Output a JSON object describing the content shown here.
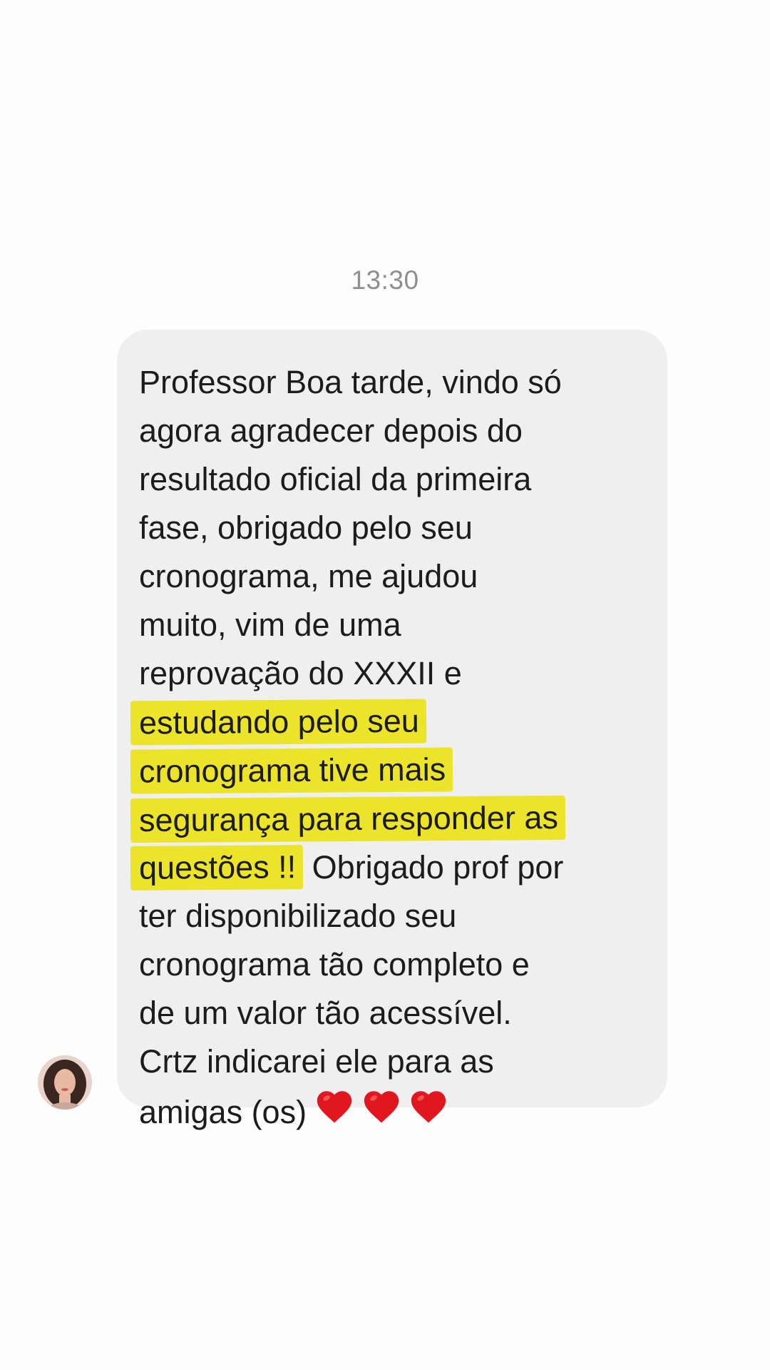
{
  "chat": {
    "timestamp": "13:30",
    "message": {
      "lines": [
        "Professor Boa tarde, vindo só",
        "agora agradecer depois do",
        "resultado oficial da primeira",
        "fase, obrigado pelo seu",
        "cronograma, me ajudou",
        "muito, vim de uma",
        "reprovação do XXXII e",
        "estudando pelo seu",
        "cronograma tive mais",
        "segurança para responder as",
        "questões !!",
        "Obrigado prof por",
        "ter disponibilizado seu",
        "cronograma tão completo e",
        "de um valor tão acessível.",
        "Crtz indicarei ele para as",
        "amigas (os)"
      ],
      "emojis": [
        "red-heart",
        "red-heart",
        "red-heart"
      ]
    }
  },
  "colors": {
    "bubble": "#efefef",
    "highlight": "#ece32b",
    "timestamp": "#8e8e93",
    "heart": "#e0171f"
  }
}
